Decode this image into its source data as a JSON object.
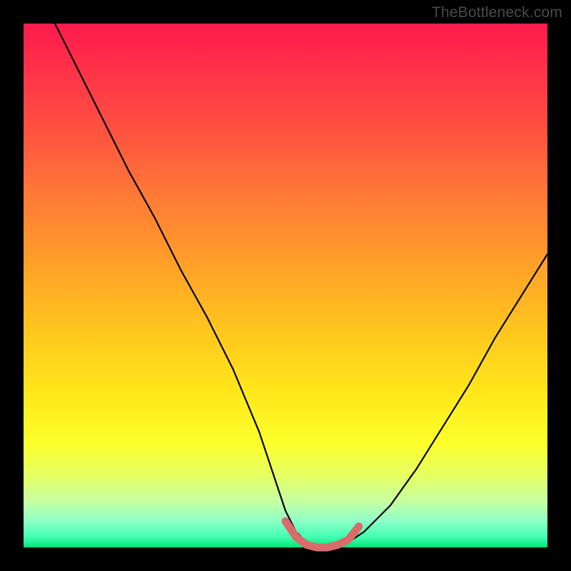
{
  "watermark": "TheBottleneck.com",
  "chart_data": {
    "type": "line",
    "title": "",
    "xlabel": "",
    "ylabel": "",
    "xlim": [
      0,
      100
    ],
    "ylim": [
      0,
      100
    ],
    "series": [
      {
        "name": "main-curve",
        "color": "#000000",
        "x": [
          6,
          10,
          15,
          20,
          25,
          30,
          35,
          40,
          45,
          48,
          50,
          52,
          54,
          56,
          58,
          60,
          62,
          65,
          70,
          75,
          80,
          85,
          90,
          95,
          100
        ],
        "y": [
          100,
          92,
          82,
          72,
          63,
          53,
          44,
          34,
          22,
          13,
          7,
          3,
          1,
          0,
          0,
          0,
          1,
          3,
          8,
          15,
          23,
          31,
          40,
          48,
          56
        ]
      },
      {
        "name": "bottom-segment",
        "color": "#e06666",
        "x": [
          50,
          52,
          54,
          56,
          58,
          60,
          62,
          64
        ],
        "y": [
          5,
          2,
          0.5,
          0,
          0,
          0.5,
          1.5,
          4
        ]
      }
    ]
  }
}
